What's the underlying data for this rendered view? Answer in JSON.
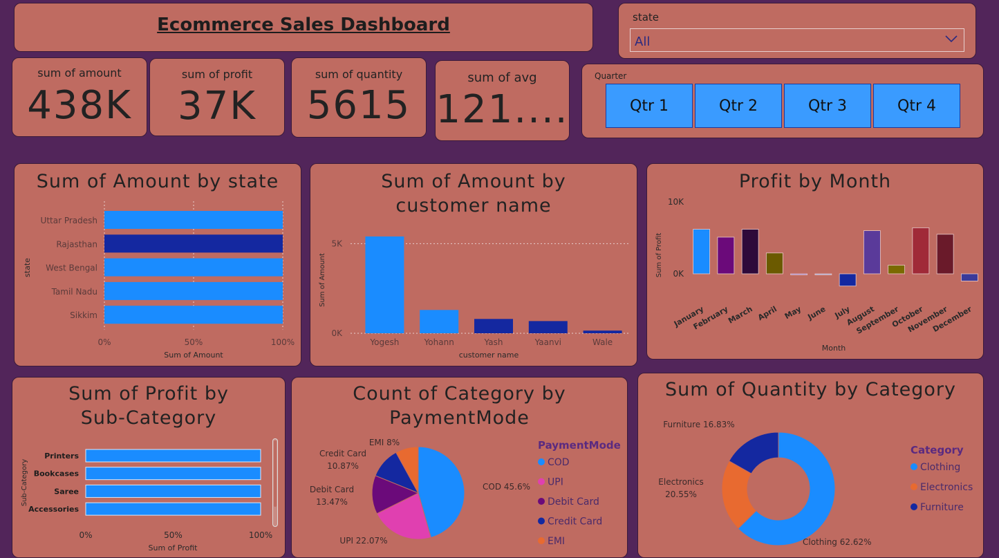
{
  "header": {
    "title": "Ecommerce Sales Dashboard"
  },
  "state_filter": {
    "label": "state",
    "value": "All"
  },
  "kpis": [
    {
      "label": "sum of amount",
      "value": "438K"
    },
    {
      "label": "sum of profit",
      "value": "37K"
    },
    {
      "label": "sum of quantity",
      "value": "5615"
    },
    {
      "label": "sum of avg",
      "value": "121...."
    }
  ],
  "quarter_slicer": {
    "label": "Quarter",
    "options": [
      "Qtr 1",
      "Qtr 2",
      "Qtr 3",
      "Qtr 4"
    ]
  },
  "colors": {
    "background": "#52255a",
    "card": "#bf6b61",
    "primary_blue": "#1a8cff",
    "dark_blue": "#1428a0"
  },
  "chart_data": [
    {
      "type": "bar",
      "orientation": "horizontal",
      "title": "Sum of Amount by state",
      "categories": [
        "Uttar Pradesh",
        "Rajasthan",
        "West Bengal",
        "Tamil Nadu",
        "Sikkim"
      ],
      "values": [
        100,
        100,
        100,
        100,
        100
      ],
      "highlight": "Rajasthan",
      "xlabel": "Sum of Amount",
      "ylabel": "state",
      "xticks": [
        "0%",
        "50%",
        "100%"
      ],
      "grid": true
    },
    {
      "type": "bar",
      "title": "Sum of Amount by customer name",
      "categories": [
        "Yogesh",
        "Yohann",
        "Yash",
        "Yaanvi",
        "Wale"
      ],
      "values": [
        5400,
        1300,
        800,
        680,
        150
      ],
      "xlabel": "customer name",
      "ylabel": "Sum of Amount",
      "yticks": [
        "0K",
        "5K"
      ],
      "ylim": [
        0,
        5400
      ],
      "grid": true
    },
    {
      "type": "bar",
      "title": "Profit by Month",
      "categories": [
        "January",
        "February",
        "March",
        "April",
        "May",
        "June",
        "July",
        "August",
        "September",
        "October",
        "November",
        "December"
      ],
      "values": [
        6200,
        5100,
        6200,
        2900,
        -100,
        -100,
        -1700,
        6000,
        1200,
        6400,
        5500,
        -1000
      ],
      "colors": [
        "#1a8cff",
        "#6b0a7a",
        "#2e0a3a",
        "#6b5a00",
        "#8a6ad0",
        "#8a9ad8",
        "#1428a0",
        "#5a3a9a",
        "#7a6a00",
        "#a02a38",
        "#6a1a2a",
        "#3a3a9a"
      ],
      "xlabel": "Month",
      "ylabel": "Sum of Profit",
      "yticks": [
        "0K",
        "10K"
      ],
      "ylim": [
        -2000,
        10000
      ]
    },
    {
      "type": "bar",
      "orientation": "horizontal",
      "title": "Sum of Profit by Sub-Category",
      "categories": [
        "Printers",
        "Bookcases",
        "Saree",
        "Accessories"
      ],
      "values": [
        100,
        100,
        100,
        100
      ],
      "xlabel": "Sum of Profit",
      "ylabel": "Sub-Category",
      "xticks": [
        "0%",
        "50%",
        "100%"
      ]
    },
    {
      "type": "pie",
      "title": "Count of Category by PaymentMode",
      "legend_title": "PaymentMode",
      "labels": [
        "COD",
        "UPI",
        "Debit Card",
        "Credit Card",
        "EMI"
      ],
      "values": [
        45.6,
        22.07,
        13.47,
        10.87,
        8
      ],
      "slice_labels": [
        "COD 45.6%",
        "UPI 22.07%",
        "Debit Card 13.47%",
        "Credit Card 10.87%",
        "EMI 8%"
      ],
      "colors": [
        "#1a8cff",
        "#e040b0",
        "#6b0a7a",
        "#1428a0",
        "#e86a30"
      ],
      "legend_placement": "right"
    },
    {
      "type": "pie",
      "variant": "donut",
      "title": "Sum of Quantity by Category",
      "legend_title": "Category",
      "labels": [
        "Clothing",
        "Electronics",
        "Furniture"
      ],
      "values": [
        62.62,
        20.55,
        16.83
      ],
      "slice_labels": [
        "Clothing 62.62%",
        "Electronics 20.55%",
        "Furniture 16.83%"
      ],
      "colors": [
        "#1a8cff",
        "#e86a30",
        "#1428a0"
      ],
      "legend_placement": "right"
    }
  ]
}
